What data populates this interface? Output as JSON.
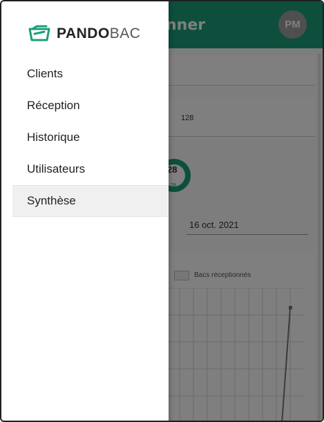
{
  "app": {
    "appbar_title": "nner",
    "avatar_initials": "PM",
    "summary_value": "128",
    "donut_value": "28",
    "donut_sub": "28",
    "date_value": "16 oct. 2021",
    "chart_legend": "Bacs réceptionnés"
  },
  "drawer": {
    "logo_strong": "PANDO",
    "logo_light": "BAC",
    "items": [
      {
        "label": "Clients"
      },
      {
        "label": "Réception"
      },
      {
        "label": "Historique"
      },
      {
        "label": "Utilisateurs"
      },
      {
        "label": "Synthèse"
      }
    ],
    "active_index": 4
  },
  "colors": {
    "brand_green": "#1a9e78",
    "overlay": "rgba(0,0,0,0.5)"
  }
}
